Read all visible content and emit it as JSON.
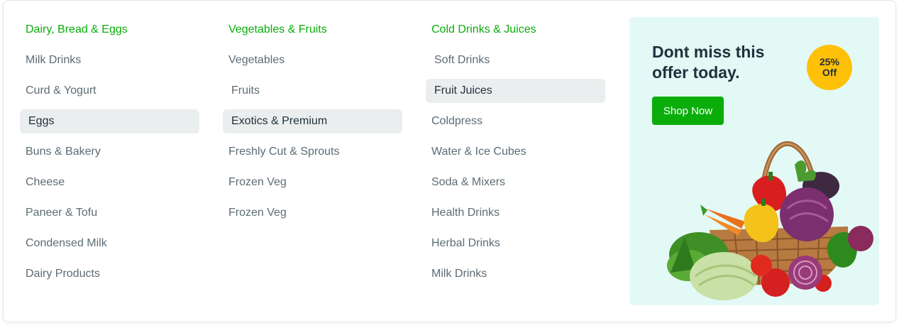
{
  "columns": [
    {
      "heading": "Dairy, Bread & Eggs",
      "items": [
        "Milk Drinks",
        "Curd & Yogurt",
        "Eggs",
        "Buns & Bakery",
        "Cheese",
        "Paneer & Tofu",
        "Condensed Milk",
        "Dairy Products"
      ],
      "active_index": 2
    },
    {
      "heading": "Vegetables & Fruits",
      "items": [
        "Vegetables",
        "Fruits",
        "Exotics & Premium",
        "Freshly Cut & Sprouts",
        "Frozen Veg",
        "Frozen Veg"
      ],
      "active_index": 2
    },
    {
      "heading": "Cold Drinks & Juices",
      "items": [
        "Soft Drinks",
        "Fruit Juices",
        "Coldpress",
        "Water & Ice Cubes",
        "Soda & Mixers",
        "Health Drinks",
        "Herbal Drinks",
        "Milk Drinks"
      ],
      "active_index": 1
    }
  ],
  "promo": {
    "title": "Dont miss this offer today.",
    "badge_percent": "25%",
    "badge_off": "Off",
    "button_label": "Shop Now",
    "image_icon": "vegetable-basket-image"
  },
  "colors": {
    "accent_green": "#0aad0a",
    "badge_yellow": "#ffc107",
    "promo_bg": "#e3f9f6",
    "active_bg": "#ebeeee",
    "text_gray": "#5c6c75",
    "text_dark": "#21313c"
  }
}
